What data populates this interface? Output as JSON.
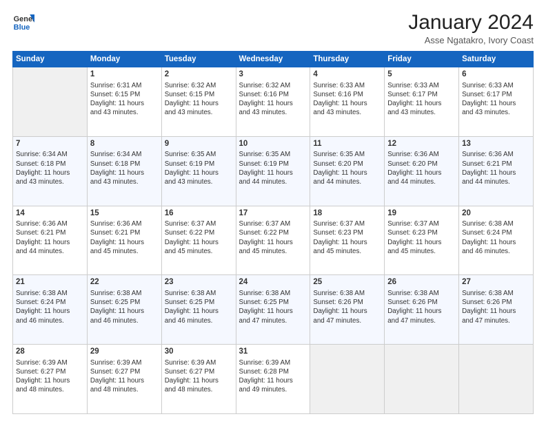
{
  "header": {
    "logo_line1": "General",
    "logo_line2": "Blue",
    "month_title": "January 2024",
    "location": "Asse Ngatakro, Ivory Coast"
  },
  "weekdays": [
    "Sunday",
    "Monday",
    "Tuesday",
    "Wednesday",
    "Thursday",
    "Friday",
    "Saturday"
  ],
  "weeks": [
    [
      {
        "day": "",
        "info": ""
      },
      {
        "day": "1",
        "info": "Sunrise: 6:31 AM\nSunset: 6:15 PM\nDaylight: 11 hours\nand 43 minutes."
      },
      {
        "day": "2",
        "info": "Sunrise: 6:32 AM\nSunset: 6:15 PM\nDaylight: 11 hours\nand 43 minutes."
      },
      {
        "day": "3",
        "info": "Sunrise: 6:32 AM\nSunset: 6:16 PM\nDaylight: 11 hours\nand 43 minutes."
      },
      {
        "day": "4",
        "info": "Sunrise: 6:33 AM\nSunset: 6:16 PM\nDaylight: 11 hours\nand 43 minutes."
      },
      {
        "day": "5",
        "info": "Sunrise: 6:33 AM\nSunset: 6:17 PM\nDaylight: 11 hours\nand 43 minutes."
      },
      {
        "day": "6",
        "info": "Sunrise: 6:33 AM\nSunset: 6:17 PM\nDaylight: 11 hours\nand 43 minutes."
      }
    ],
    [
      {
        "day": "7",
        "info": "Sunrise: 6:34 AM\nSunset: 6:18 PM\nDaylight: 11 hours\nand 43 minutes."
      },
      {
        "day": "8",
        "info": "Sunrise: 6:34 AM\nSunset: 6:18 PM\nDaylight: 11 hours\nand 43 minutes."
      },
      {
        "day": "9",
        "info": "Sunrise: 6:35 AM\nSunset: 6:19 PM\nDaylight: 11 hours\nand 43 minutes."
      },
      {
        "day": "10",
        "info": "Sunrise: 6:35 AM\nSunset: 6:19 PM\nDaylight: 11 hours\nand 44 minutes."
      },
      {
        "day": "11",
        "info": "Sunrise: 6:35 AM\nSunset: 6:20 PM\nDaylight: 11 hours\nand 44 minutes."
      },
      {
        "day": "12",
        "info": "Sunrise: 6:36 AM\nSunset: 6:20 PM\nDaylight: 11 hours\nand 44 minutes."
      },
      {
        "day": "13",
        "info": "Sunrise: 6:36 AM\nSunset: 6:21 PM\nDaylight: 11 hours\nand 44 minutes."
      }
    ],
    [
      {
        "day": "14",
        "info": "Sunrise: 6:36 AM\nSunset: 6:21 PM\nDaylight: 11 hours\nand 44 minutes."
      },
      {
        "day": "15",
        "info": "Sunrise: 6:36 AM\nSunset: 6:21 PM\nDaylight: 11 hours\nand 45 minutes."
      },
      {
        "day": "16",
        "info": "Sunrise: 6:37 AM\nSunset: 6:22 PM\nDaylight: 11 hours\nand 45 minutes."
      },
      {
        "day": "17",
        "info": "Sunrise: 6:37 AM\nSunset: 6:22 PM\nDaylight: 11 hours\nand 45 minutes."
      },
      {
        "day": "18",
        "info": "Sunrise: 6:37 AM\nSunset: 6:23 PM\nDaylight: 11 hours\nand 45 minutes."
      },
      {
        "day": "19",
        "info": "Sunrise: 6:37 AM\nSunset: 6:23 PM\nDaylight: 11 hours\nand 45 minutes."
      },
      {
        "day": "20",
        "info": "Sunrise: 6:38 AM\nSunset: 6:24 PM\nDaylight: 11 hours\nand 46 minutes."
      }
    ],
    [
      {
        "day": "21",
        "info": "Sunrise: 6:38 AM\nSunset: 6:24 PM\nDaylight: 11 hours\nand 46 minutes."
      },
      {
        "day": "22",
        "info": "Sunrise: 6:38 AM\nSunset: 6:25 PM\nDaylight: 11 hours\nand 46 minutes."
      },
      {
        "day": "23",
        "info": "Sunrise: 6:38 AM\nSunset: 6:25 PM\nDaylight: 11 hours\nand 46 minutes."
      },
      {
        "day": "24",
        "info": "Sunrise: 6:38 AM\nSunset: 6:25 PM\nDaylight: 11 hours\nand 47 minutes."
      },
      {
        "day": "25",
        "info": "Sunrise: 6:38 AM\nSunset: 6:26 PM\nDaylight: 11 hours\nand 47 minutes."
      },
      {
        "day": "26",
        "info": "Sunrise: 6:38 AM\nSunset: 6:26 PM\nDaylight: 11 hours\nand 47 minutes."
      },
      {
        "day": "27",
        "info": "Sunrise: 6:38 AM\nSunset: 6:26 PM\nDaylight: 11 hours\nand 47 minutes."
      }
    ],
    [
      {
        "day": "28",
        "info": "Sunrise: 6:39 AM\nSunset: 6:27 PM\nDaylight: 11 hours\nand 48 minutes."
      },
      {
        "day": "29",
        "info": "Sunrise: 6:39 AM\nSunset: 6:27 PM\nDaylight: 11 hours\nand 48 minutes."
      },
      {
        "day": "30",
        "info": "Sunrise: 6:39 AM\nSunset: 6:27 PM\nDaylight: 11 hours\nand 48 minutes."
      },
      {
        "day": "31",
        "info": "Sunrise: 6:39 AM\nSunset: 6:28 PM\nDaylight: 11 hours\nand 49 minutes."
      },
      {
        "day": "",
        "info": ""
      },
      {
        "day": "",
        "info": ""
      },
      {
        "day": "",
        "info": ""
      }
    ]
  ]
}
